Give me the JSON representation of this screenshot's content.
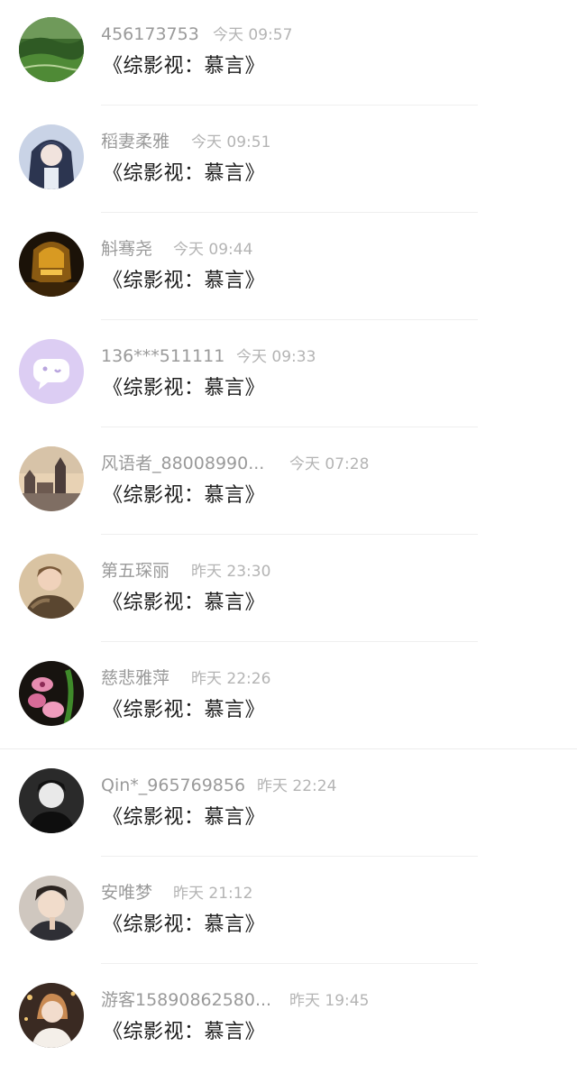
{
  "messages": [
    {
      "name": "456173753",
      "time": "今天 09:57",
      "text": "《综影视：慕言》",
      "avatar": "green-landscape"
    },
    {
      "name": "稻妻柔雅",
      "time": "今天 09:51",
      "text": "《综影视：慕言》",
      "avatar": "anime-girl"
    },
    {
      "name": "斛骞尧",
      "time": "今天 09:44",
      "text": "《综影视：慕言》",
      "avatar": "gold-helmet"
    },
    {
      "name": "136***511111",
      "time": "今天 09:33",
      "text": "《综影视：慕言》",
      "avatar": "chat-bubble-default"
    },
    {
      "name": "风语者_88008990...",
      "time": "今天 07:28",
      "text": "《综影视：慕言》",
      "avatar": "castle-city"
    },
    {
      "name": "第五琛丽",
      "time": "昨天 23:30",
      "text": "《综影视：慕言》",
      "avatar": "woman-fur-coat"
    },
    {
      "name": "慈悲雅萍",
      "time": "昨天 22:26",
      "text": "《综影视：慕言》",
      "avatar": "pink-orchid"
    },
    {
      "name": "Qin*_965769856",
      "time": "昨天 22:24",
      "text": "《综影视：慕言》",
      "avatar": "bw-portrait"
    },
    {
      "name": "安唯梦",
      "time": "昨天 21:12",
      "text": "《综影视：慕言》",
      "avatar": "man-portrait"
    },
    {
      "name": "游客15890862580...",
      "time": "昨天 19:45",
      "text": "《综影视：慕言》",
      "avatar": "woman-night"
    }
  ]
}
